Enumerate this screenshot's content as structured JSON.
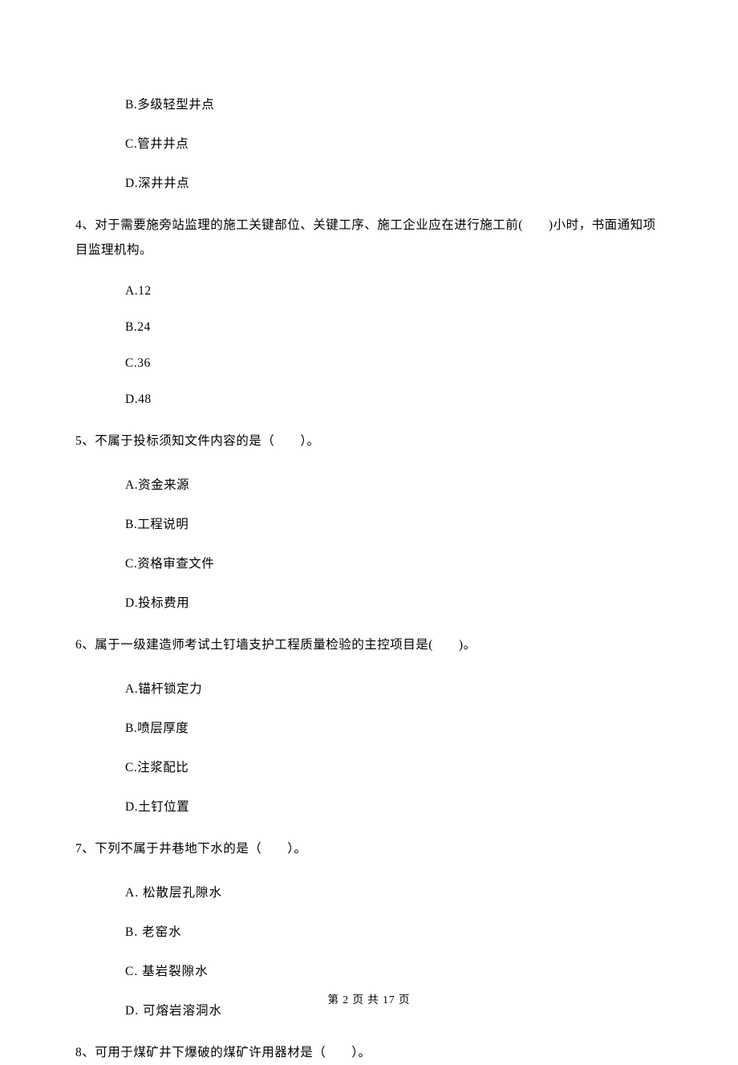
{
  "q3": {
    "optB": "B.多级轻型井点",
    "optC": "C.管井井点",
    "optD": "D.深井井点"
  },
  "q4": {
    "stem": "4、对于需要施旁站监理的施工关键部位、关键工序、施工企业应在进行施工前(　　)小时，书面通知项目监理机构。",
    "optA": "A.12",
    "optB": "B.24",
    "optC": "C.36",
    "optD": "D.48"
  },
  "q5": {
    "stem": "5、不属于投标须知文件内容的是（　　）。",
    "optA": "A.资金来源",
    "optB": "B.工程说明",
    "optC": "C.资格审查文件",
    "optD": "D.投标费用"
  },
  "q6": {
    "stem": "6、属于一级建造师考试土钉墙支护工程质量检验的主控项目是(　　)。",
    "optA": "A.锚杆锁定力",
    "optB": "B.喷层厚度",
    "optC": "C.注浆配比",
    "optD": "D.土钉位置"
  },
  "q7": {
    "stem": "7、下列不属于井巷地下水的是（　　）。",
    "optA": "A. 松散层孔隙水",
    "optB": "B. 老窑水",
    "optC": "C. 基岩裂隙水",
    "optD": "D. 可熔岩溶洞水"
  },
  "q8": {
    "stem": "8、可用于煤矿井下爆破的煤矿许用器材是（　　）。"
  },
  "footer": "第 2 页 共 17 页"
}
